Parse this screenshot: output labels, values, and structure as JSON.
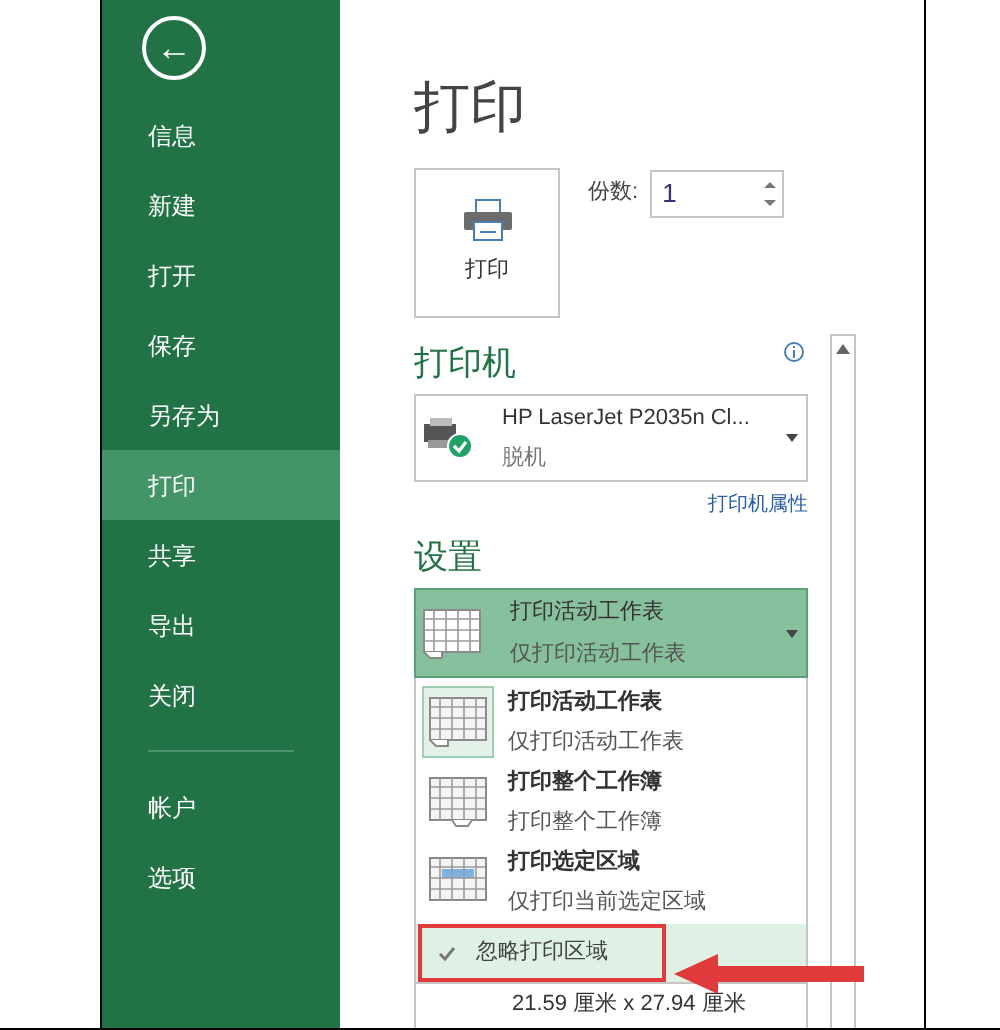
{
  "sidebar": {
    "back_button": {
      "label": "←"
    },
    "items": [
      {
        "label": "信息",
        "selected": false
      },
      {
        "label": "新建",
        "selected": false
      },
      {
        "label": "打开",
        "selected": false
      },
      {
        "label": "保存",
        "selected": false
      },
      {
        "label": "另存为",
        "selected": false
      },
      {
        "label": "打印",
        "selected": true
      },
      {
        "label": "共享",
        "selected": false
      },
      {
        "label": "导出",
        "selected": false
      },
      {
        "label": "关闭",
        "selected": false
      }
    ],
    "bottom_items": [
      {
        "label": "帐户",
        "selected": false
      },
      {
        "label": "选项",
        "selected": false
      }
    ]
  },
  "title": "打印",
  "print_button": {
    "label": "打印"
  },
  "copies": {
    "label": "份数:",
    "value": "1"
  },
  "printer": {
    "heading": "打印机",
    "name": "HP LaserJet P2035n Cl...",
    "status": "脱机",
    "properties_link": "打印机属性"
  },
  "settings": {
    "heading": "设置",
    "dropdown": {
      "title": "打印活动工作表",
      "subtitle": "仅打印活动工作表",
      "expanded": true
    },
    "options": [
      {
        "kind": "sheet",
        "title": "打印活动工作表",
        "subtitle": "仅打印活动工作表",
        "selected": true
      },
      {
        "kind": "workbook",
        "title": "打印整个工作簿",
        "subtitle": "打印整个工作簿",
        "selected": false
      },
      {
        "kind": "selection",
        "title": "打印选定区域",
        "subtitle": "仅打印当前选定区域",
        "selected": false
      }
    ],
    "ignore_print_area": {
      "label": "忽略打印区域",
      "checked": true
    },
    "paper_size": "21.59 厘米 x 27.94 厘米"
  }
}
